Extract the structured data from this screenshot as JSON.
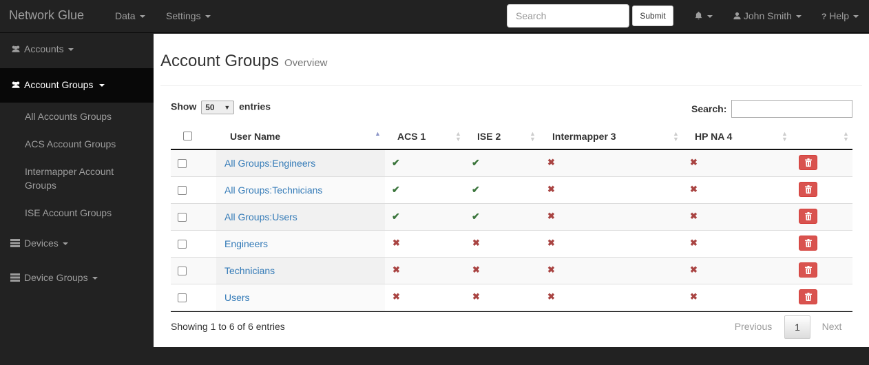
{
  "navbar": {
    "brand": "Network Glue",
    "data_menu": "Data",
    "settings_menu": "Settings",
    "search_placeholder": "Search",
    "submit_label": "Submit",
    "user_menu": "John Smith",
    "help_menu": "Help",
    "icons": [
      "bell-icon",
      "user-icon",
      "question-icon"
    ]
  },
  "sidebar": {
    "items": [
      {
        "label": "Accounts",
        "icon": "users-icon"
      },
      {
        "label": "Account Groups",
        "icon": "users-icon"
      },
      {
        "label": "Devices",
        "icon": "server-icon"
      },
      {
        "label": "Device Groups",
        "icon": "server-icon"
      }
    ],
    "subitems": [
      "All Accounts Groups",
      "ACS Account Groups",
      "Intermapper Account Groups",
      "ISE Account Groups"
    ]
  },
  "page": {
    "title": "Account Groups",
    "subtitle": "Overview"
  },
  "table_controls": {
    "show_label": "Show",
    "page_length": "50",
    "entries_label": "entries",
    "search_label": "Search:",
    "info": "Showing 1 to 6 of 6 entries",
    "previous": "Previous",
    "current_page": "1",
    "next": "Next"
  },
  "table": {
    "columns": [
      "User Name",
      "ACS 1",
      "ISE 2",
      "Intermapper 3",
      "HP NA 4"
    ],
    "rows": [
      {
        "name": "All Groups:Engineers",
        "acs": true,
        "ise": true,
        "intermapper": false,
        "hpna": false
      },
      {
        "name": "All Groups:Technicians",
        "acs": true,
        "ise": true,
        "intermapper": false,
        "hpna": false
      },
      {
        "name": "All Groups:Users",
        "acs": true,
        "ise": true,
        "intermapper": false,
        "hpna": false
      },
      {
        "name": "Engineers",
        "acs": false,
        "ise": false,
        "intermapper": false,
        "hpna": false
      },
      {
        "name": "Technicians",
        "acs": false,
        "ise": false,
        "intermapper": false,
        "hpna": false
      },
      {
        "name": "Users",
        "acs": false,
        "ise": false,
        "intermapper": false,
        "hpna": false
      }
    ]
  },
  "colors": {
    "navbar_bg": "#222222",
    "active_sidebar_bg": "#080808",
    "link": "#337ab7",
    "check": "#3c763d",
    "cross": "#a94442",
    "delete_button": "#d9534f"
  }
}
